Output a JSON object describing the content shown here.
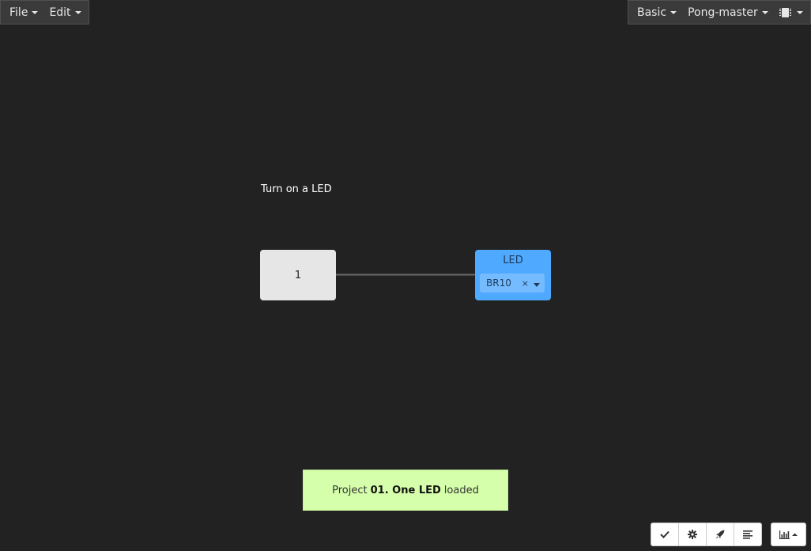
{
  "menu_left": {
    "file": "File",
    "edit": "Edit"
  },
  "menu_right": {
    "mode": "Basic",
    "board": "Pong-master"
  },
  "canvas": {
    "project_title": "Turn on a LED",
    "constant_value": "1",
    "led_label": "LED",
    "led_pin": "BR10",
    "clear_symbol": "×"
  },
  "notice": {
    "prefix": "Project",
    "name": "01. One LED",
    "suffix": "loaded"
  },
  "toolbar": {
    "icons": [
      "check-icon",
      "gear-icon",
      "rocket-icon",
      "align-left-icon",
      "bar-chart-icon"
    ]
  },
  "colors": {
    "background": "#222222",
    "led_block": "#4fa9ff",
    "constant_block": "#e6e6e6",
    "notice_bg": "#d5ffaa"
  }
}
